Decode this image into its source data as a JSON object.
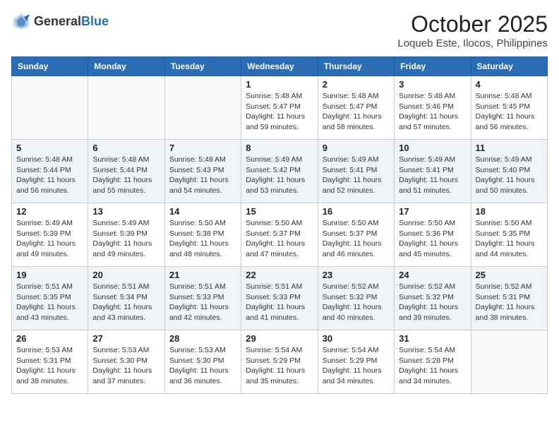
{
  "header": {
    "logo_general": "General",
    "logo_blue": "Blue",
    "month_title": "October 2025",
    "location": "Loqueb Este, Ilocos, Philippines"
  },
  "weekdays": [
    "Sunday",
    "Monday",
    "Tuesday",
    "Wednesday",
    "Thursday",
    "Friday",
    "Saturday"
  ],
  "weeks": [
    [
      {
        "day": "",
        "sunrise": "",
        "sunset": "",
        "daylight": ""
      },
      {
        "day": "",
        "sunrise": "",
        "sunset": "",
        "daylight": ""
      },
      {
        "day": "",
        "sunrise": "",
        "sunset": "",
        "daylight": ""
      },
      {
        "day": "1",
        "sunrise": "Sunrise: 5:48 AM",
        "sunset": "Sunset: 5:47 PM",
        "daylight": "Daylight: 11 hours and 59 minutes."
      },
      {
        "day": "2",
        "sunrise": "Sunrise: 5:48 AM",
        "sunset": "Sunset: 5:47 PM",
        "daylight": "Daylight: 11 hours and 58 minutes."
      },
      {
        "day": "3",
        "sunrise": "Sunrise: 5:48 AM",
        "sunset": "Sunset: 5:46 PM",
        "daylight": "Daylight: 11 hours and 57 minutes."
      },
      {
        "day": "4",
        "sunrise": "Sunrise: 5:48 AM",
        "sunset": "Sunset: 5:45 PM",
        "daylight": "Daylight: 11 hours and 56 minutes."
      }
    ],
    [
      {
        "day": "5",
        "sunrise": "Sunrise: 5:48 AM",
        "sunset": "Sunset: 5:44 PM",
        "daylight": "Daylight: 11 hours and 56 minutes."
      },
      {
        "day": "6",
        "sunrise": "Sunrise: 5:48 AM",
        "sunset": "Sunset: 5:44 PM",
        "daylight": "Daylight: 11 hours and 55 minutes."
      },
      {
        "day": "7",
        "sunrise": "Sunrise: 5:48 AM",
        "sunset": "Sunset: 5:43 PM",
        "daylight": "Daylight: 11 hours and 54 minutes."
      },
      {
        "day": "8",
        "sunrise": "Sunrise: 5:49 AM",
        "sunset": "Sunset: 5:42 PM",
        "daylight": "Daylight: 11 hours and 53 minutes."
      },
      {
        "day": "9",
        "sunrise": "Sunrise: 5:49 AM",
        "sunset": "Sunset: 5:41 PM",
        "daylight": "Daylight: 11 hours and 52 minutes."
      },
      {
        "day": "10",
        "sunrise": "Sunrise: 5:49 AM",
        "sunset": "Sunset: 5:41 PM",
        "daylight": "Daylight: 11 hours and 51 minutes."
      },
      {
        "day": "11",
        "sunrise": "Sunrise: 5:49 AM",
        "sunset": "Sunset: 5:40 PM",
        "daylight": "Daylight: 11 hours and 50 minutes."
      }
    ],
    [
      {
        "day": "12",
        "sunrise": "Sunrise: 5:49 AM",
        "sunset": "Sunset: 5:39 PM",
        "daylight": "Daylight: 11 hours and 49 minutes."
      },
      {
        "day": "13",
        "sunrise": "Sunrise: 5:49 AM",
        "sunset": "Sunset: 5:39 PM",
        "daylight": "Daylight: 11 hours and 49 minutes."
      },
      {
        "day": "14",
        "sunrise": "Sunrise: 5:50 AM",
        "sunset": "Sunset: 5:38 PM",
        "daylight": "Daylight: 11 hours and 48 minutes."
      },
      {
        "day": "15",
        "sunrise": "Sunrise: 5:50 AM",
        "sunset": "Sunset: 5:37 PM",
        "daylight": "Daylight: 11 hours and 47 minutes."
      },
      {
        "day": "16",
        "sunrise": "Sunrise: 5:50 AM",
        "sunset": "Sunset: 5:37 PM",
        "daylight": "Daylight: 11 hours and 46 minutes."
      },
      {
        "day": "17",
        "sunrise": "Sunrise: 5:50 AM",
        "sunset": "Sunset: 5:36 PM",
        "daylight": "Daylight: 11 hours and 45 minutes."
      },
      {
        "day": "18",
        "sunrise": "Sunrise: 5:50 AM",
        "sunset": "Sunset: 5:35 PM",
        "daylight": "Daylight: 11 hours and 44 minutes."
      }
    ],
    [
      {
        "day": "19",
        "sunrise": "Sunrise: 5:51 AM",
        "sunset": "Sunset: 5:35 PM",
        "daylight": "Daylight: 11 hours and 43 minutes."
      },
      {
        "day": "20",
        "sunrise": "Sunrise: 5:51 AM",
        "sunset": "Sunset: 5:34 PM",
        "daylight": "Daylight: 11 hours and 43 minutes."
      },
      {
        "day": "21",
        "sunrise": "Sunrise: 5:51 AM",
        "sunset": "Sunset: 5:33 PM",
        "daylight": "Daylight: 11 hours and 42 minutes."
      },
      {
        "day": "22",
        "sunrise": "Sunrise: 5:51 AM",
        "sunset": "Sunset: 5:33 PM",
        "daylight": "Daylight: 11 hours and 41 minutes."
      },
      {
        "day": "23",
        "sunrise": "Sunrise: 5:52 AM",
        "sunset": "Sunset: 5:32 PM",
        "daylight": "Daylight: 11 hours and 40 minutes."
      },
      {
        "day": "24",
        "sunrise": "Sunrise: 5:52 AM",
        "sunset": "Sunset: 5:32 PM",
        "daylight": "Daylight: 11 hours and 39 minutes."
      },
      {
        "day": "25",
        "sunrise": "Sunrise: 5:52 AM",
        "sunset": "Sunset: 5:31 PM",
        "daylight": "Daylight: 11 hours and 38 minutes."
      }
    ],
    [
      {
        "day": "26",
        "sunrise": "Sunrise: 5:53 AM",
        "sunset": "Sunset: 5:31 PM",
        "daylight": "Daylight: 11 hours and 38 minutes."
      },
      {
        "day": "27",
        "sunrise": "Sunrise: 5:53 AM",
        "sunset": "Sunset: 5:30 PM",
        "daylight": "Daylight: 11 hours and 37 minutes."
      },
      {
        "day": "28",
        "sunrise": "Sunrise: 5:53 AM",
        "sunset": "Sunset: 5:30 PM",
        "daylight": "Daylight: 11 hours and 36 minutes."
      },
      {
        "day": "29",
        "sunrise": "Sunrise: 5:54 AM",
        "sunset": "Sunset: 5:29 PM",
        "daylight": "Daylight: 11 hours and 35 minutes."
      },
      {
        "day": "30",
        "sunrise": "Sunrise: 5:54 AM",
        "sunset": "Sunset: 5:29 PM",
        "daylight": "Daylight: 11 hours and 34 minutes."
      },
      {
        "day": "31",
        "sunrise": "Sunrise: 5:54 AM",
        "sunset": "Sunset: 5:28 PM",
        "daylight": "Daylight: 11 hours and 34 minutes."
      },
      {
        "day": "",
        "sunrise": "",
        "sunset": "",
        "daylight": ""
      }
    ]
  ]
}
